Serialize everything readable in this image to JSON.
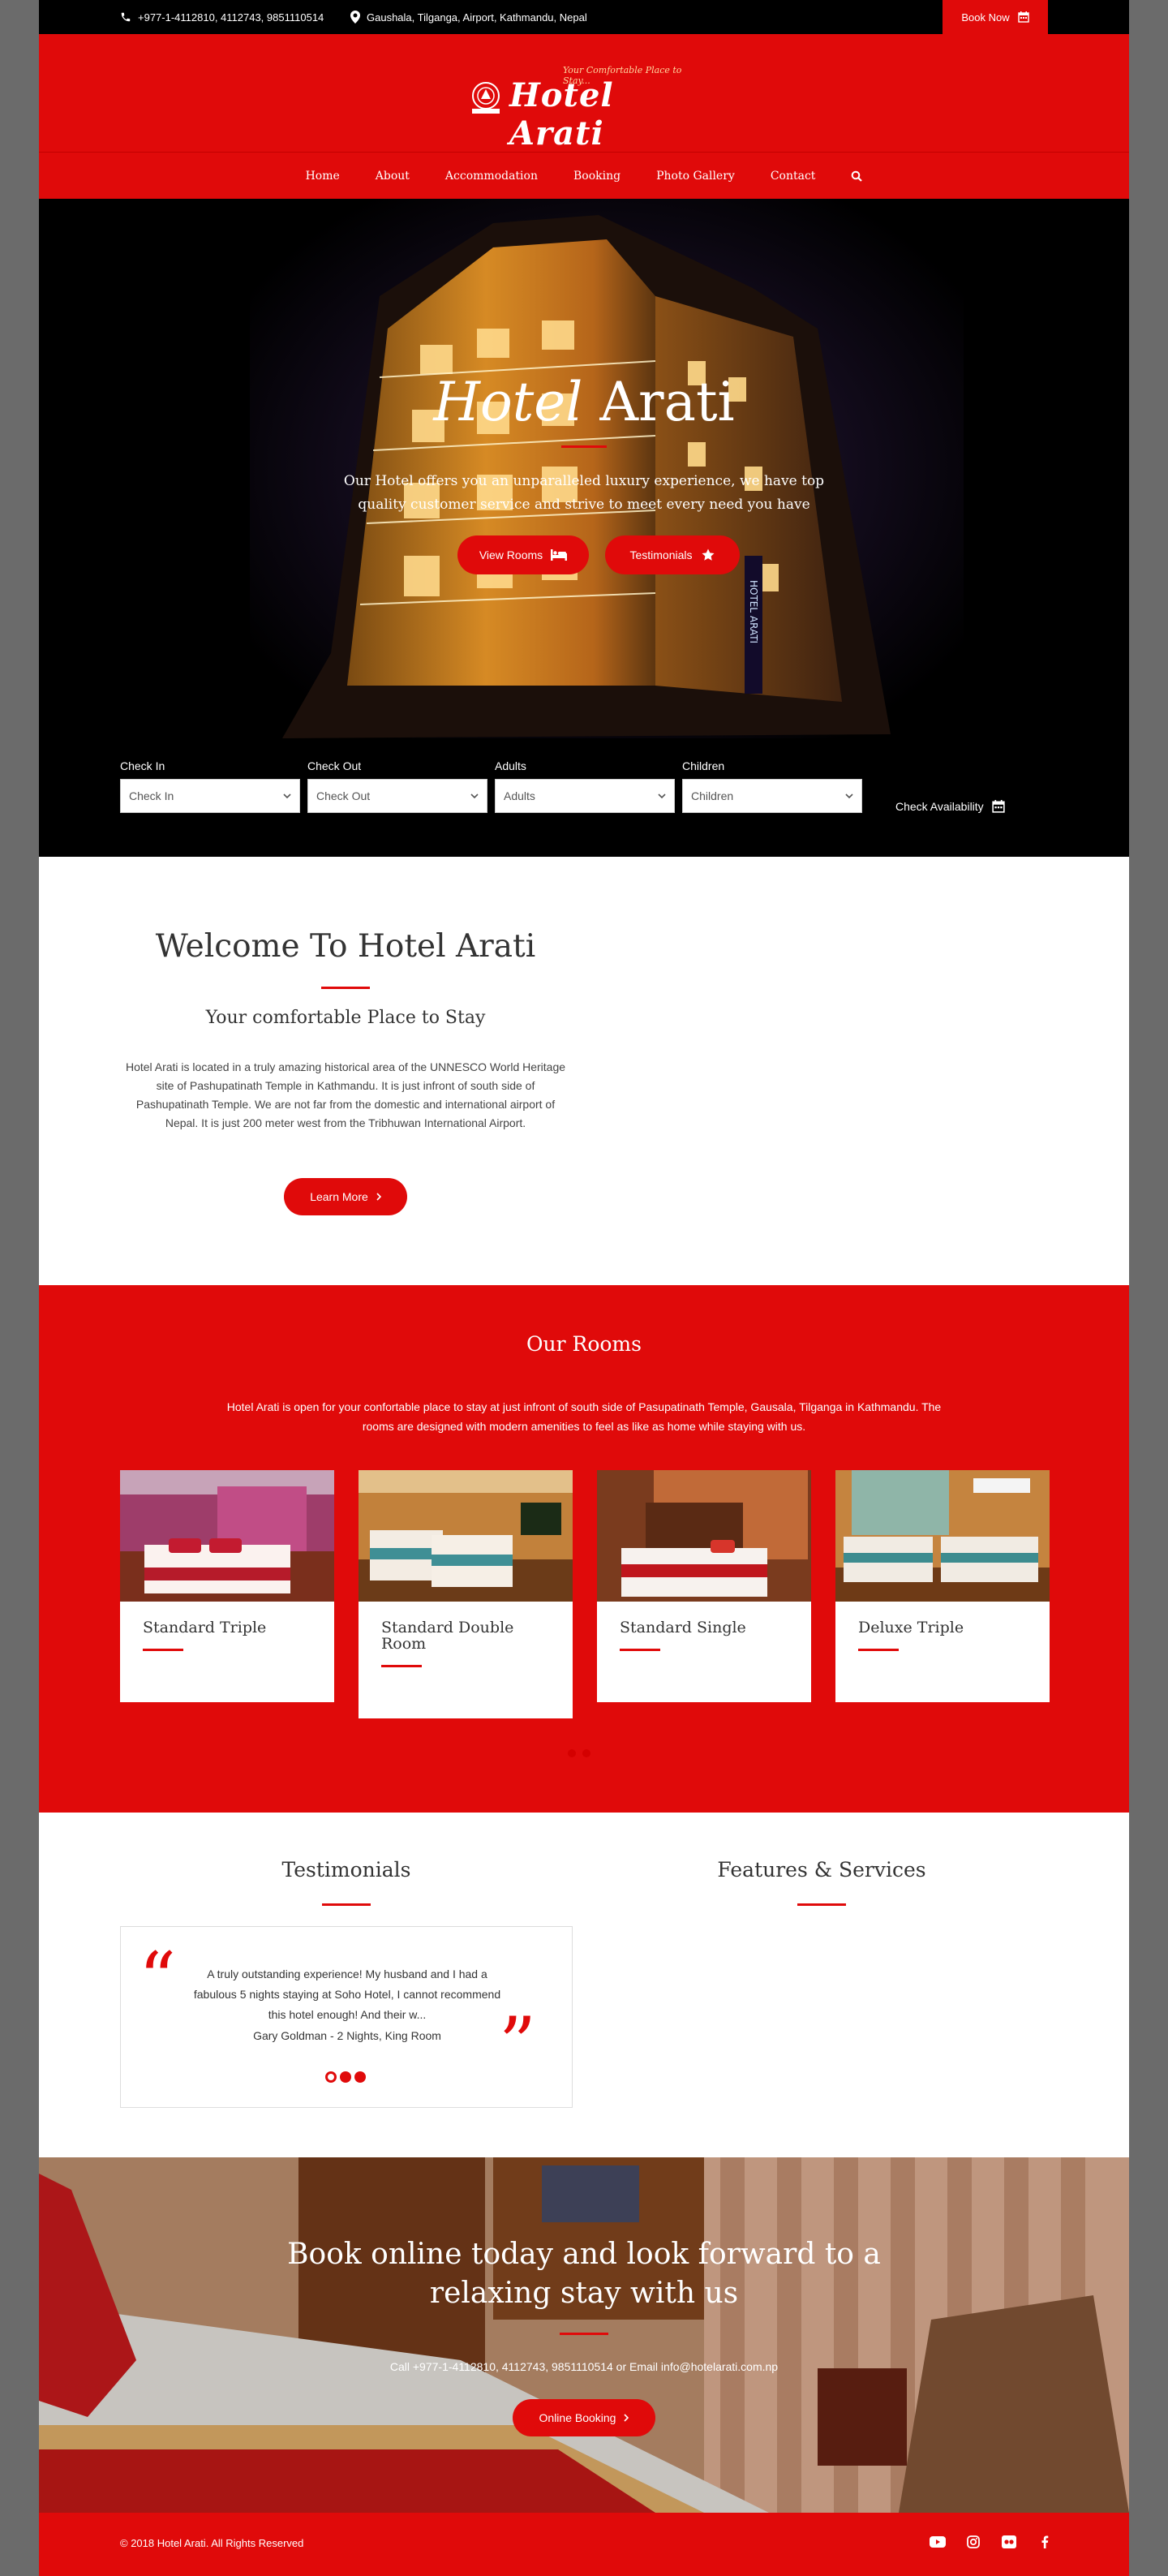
{
  "topbar": {
    "phone": "+977-1-4112810, 4112743, 9851110514",
    "address": "Gaushala, Tilganga, Airport, Kathmandu, Nepal",
    "book_now": "Book Now"
  },
  "logo": {
    "tagline": "Your Comfortable Place to Stay...",
    "name": "Hotel Arati"
  },
  "nav": [
    "Home",
    "About",
    "Accommodation",
    "Booking",
    "Photo Gallery",
    "Contact"
  ],
  "hero": {
    "title_italic": "Hotel",
    "title_rest": " Arati",
    "subtitle": "Our Hotel offers you an unparalleled luxury experience, we have top quality customer service and strive to meet every need you have",
    "btn_rooms": "View Rooms",
    "btn_testimonials": "Testimonials"
  },
  "booking": {
    "fields": [
      {
        "label": "Check In",
        "placeholder": "Check In"
      },
      {
        "label": "Check Out",
        "placeholder": "Check Out"
      },
      {
        "label": "Adults",
        "placeholder": "Adults"
      },
      {
        "label": "Children",
        "placeholder": "Children"
      }
    ],
    "check": "Check Availability"
  },
  "welcome": {
    "title": "Welcome To Hotel Arati",
    "subtitle": "Your comfortable Place to Stay",
    "text": "Hotel Arati is located in a truly amazing historical area of the UNNESCO World Heritage site of Pashupatinath Temple in Kathmandu. It is just infront of south side of Pashupatinath Temple. We are not far from the domestic and international airport of Nepal. It is just 200 meter west from the Tribhuwan International Airport.",
    "button": "Learn More"
  },
  "rooms": {
    "title": "Our Rooms",
    "text": "Hotel Arati is open for your confortable place to stay at just infront of south side of Pasupatinath Temple, Gausala, Tilganga in Kathmandu. The rooms are designed with modern amenities to feel as like as home while staying with us.",
    "cards": [
      {
        "name": "Standard Triple"
      },
      {
        "name": "Standard Double Room"
      },
      {
        "name": "Standard Single"
      },
      {
        "name": "Deluxe Triple"
      }
    ]
  },
  "testimonials": {
    "title": "Testimonials",
    "quote": "A truly outstanding experience! My husband and I had a fabulous 5 nights staying at Soho Hotel, I cannot recommend this hotel enough! And their w...",
    "author": "Gary Goldman - 2 Nights, King Room"
  },
  "features": {
    "title": "Features & Services"
  },
  "cta": {
    "title": "Book online today and look forward to a relaxing stay with us",
    "info": "Call +977-1-4112810, 4112743, 9851110514 or Email info@hotelarati.com.np",
    "button": "Online Booking"
  },
  "footer": {
    "copyright": "© 2018 Hotel Arati. All Rights Reserved"
  },
  "colors": {
    "brand_red": "#e00a0a",
    "dark": "#000000"
  }
}
